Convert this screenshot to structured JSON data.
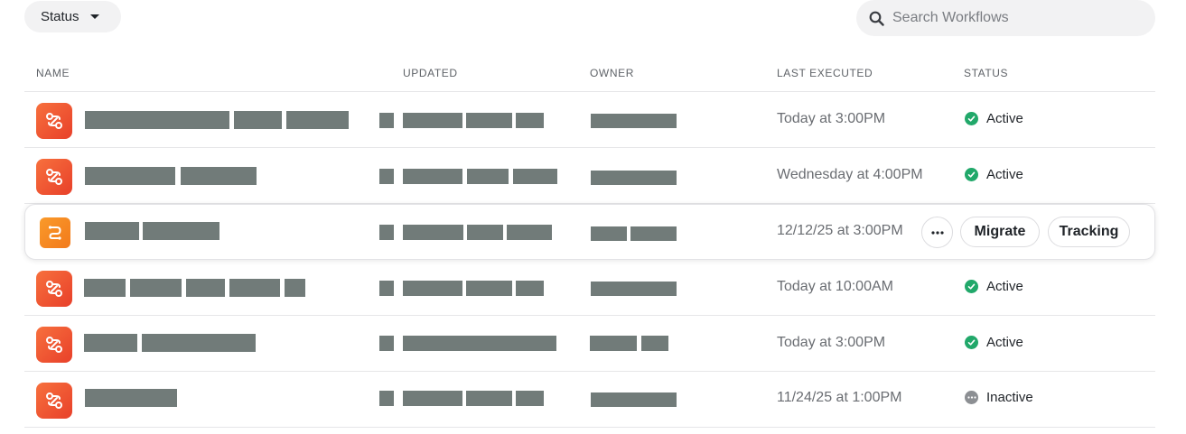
{
  "toolbar": {
    "status_filter_label": "Status",
    "search_placeholder": "Search Workflows"
  },
  "columns": {
    "name": "NAME",
    "updated": "UPDATED",
    "owner": "OWNER",
    "last_executed": "LAST EXECUTED",
    "status": "STATUS"
  },
  "rows": [
    {
      "last_executed": "Today at 3:00PM",
      "status": "Active"
    },
    {
      "last_executed": "Wednesday at 4:00PM",
      "status": "Active"
    },
    {
      "last_executed": "12/12/25 at 3:00PM",
      "actions": {
        "more": "···",
        "migrate": "Migrate",
        "tracking": "Tracking"
      }
    },
    {
      "last_executed": "Today at 10:00AM",
      "status": "Active"
    },
    {
      "last_executed": "Today at 3:00PM",
      "status": "Active"
    },
    {
      "last_executed": "11/24/25 at 1:00PM",
      "status": "Inactive"
    }
  ],
  "icons": {
    "filter_caret": "caret-down-icon",
    "search": "search-icon",
    "workflow": "workflow-icon",
    "workflow_alt": "workflow-path-icon",
    "active": "check-circle-icon",
    "inactive": "ellipsis-circle-icon"
  },
  "colors": {
    "workflow_icon": "#ec4e2e",
    "workflow_icon_alt": "#f5851f",
    "active": "#21a86a",
    "inactive": "#8c8f93",
    "redaction": "#717b79"
  }
}
